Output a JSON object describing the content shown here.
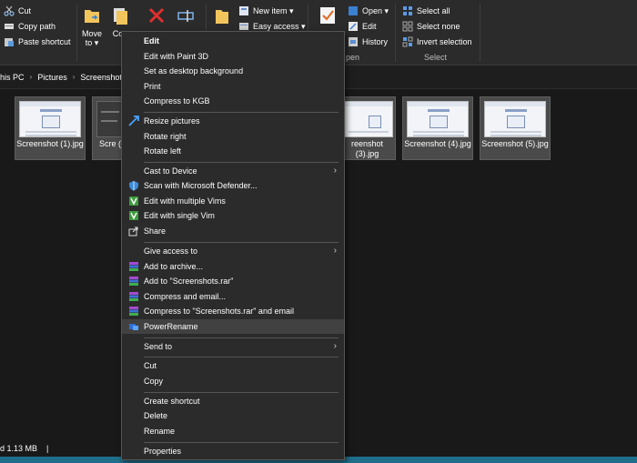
{
  "ribbon": {
    "clipboard": {
      "cut": "Cut",
      "copy_path": "Copy path",
      "paste_shortcut": "Paste shortcut"
    },
    "organize": {
      "move_to": "Move to ▾",
      "copy_to_partial": "Co t"
    },
    "new": {
      "new_item": "New item ▾",
      "easy_access": "Easy access ▾"
    },
    "open": {
      "open": "Open ▾",
      "edit": "Edit",
      "history": "History",
      "group_partial": "pen"
    },
    "select": {
      "select_all": "Select all",
      "select_none": "Select none",
      "invert_selection": "Invert selection",
      "group": "Select"
    }
  },
  "breadcrumb": {
    "seg1": "his PC",
    "seg2": "Pictures",
    "seg3": "Screenshot"
  },
  "files": [
    {
      "name": "Screenshot (1).jpg"
    },
    {
      "name": "Scre ("
    },
    {
      "name": "reenshot (3).jpg"
    },
    {
      "name": "Screenshot (4).jpg"
    },
    {
      "name": "Screenshot (5).jpg"
    }
  ],
  "status": {
    "size": "d  1.13 MB"
  },
  "menu": {
    "edit": "Edit",
    "edit_paint3d": "Edit with Paint 3D",
    "set_desktop_bg": "Set as desktop background",
    "print": "Print",
    "compress_kgb": "Compress to KGB",
    "resize_pictures": "Resize pictures",
    "rotate_right": "Rotate right",
    "rotate_left": "Rotate left",
    "cast_to_device": "Cast to Device",
    "scan_defender": "Scan with Microsoft Defender...",
    "edit_multiple_vims": "Edit with multiple Vims",
    "edit_single_vim": "Edit with single Vim",
    "share": "Share",
    "give_access": "Give access to",
    "add_archive": "Add to archive...",
    "add_rar": "Add to \"Screenshots.rar\"",
    "compress_email": "Compress and email...",
    "compress_rar_email": "Compress to \"Screenshots.rar\" and email",
    "power_rename": "PowerRename",
    "send_to": "Send to",
    "cut": "Cut",
    "copy": "Copy",
    "create_shortcut": "Create shortcut",
    "delete": "Delete",
    "rename": "Rename",
    "properties": "Properties"
  },
  "colors": {
    "menu_bg": "#2b2b2b",
    "highlight": "#414141",
    "accent": "#1f6f8b",
    "explorer_bg": "#191919"
  }
}
